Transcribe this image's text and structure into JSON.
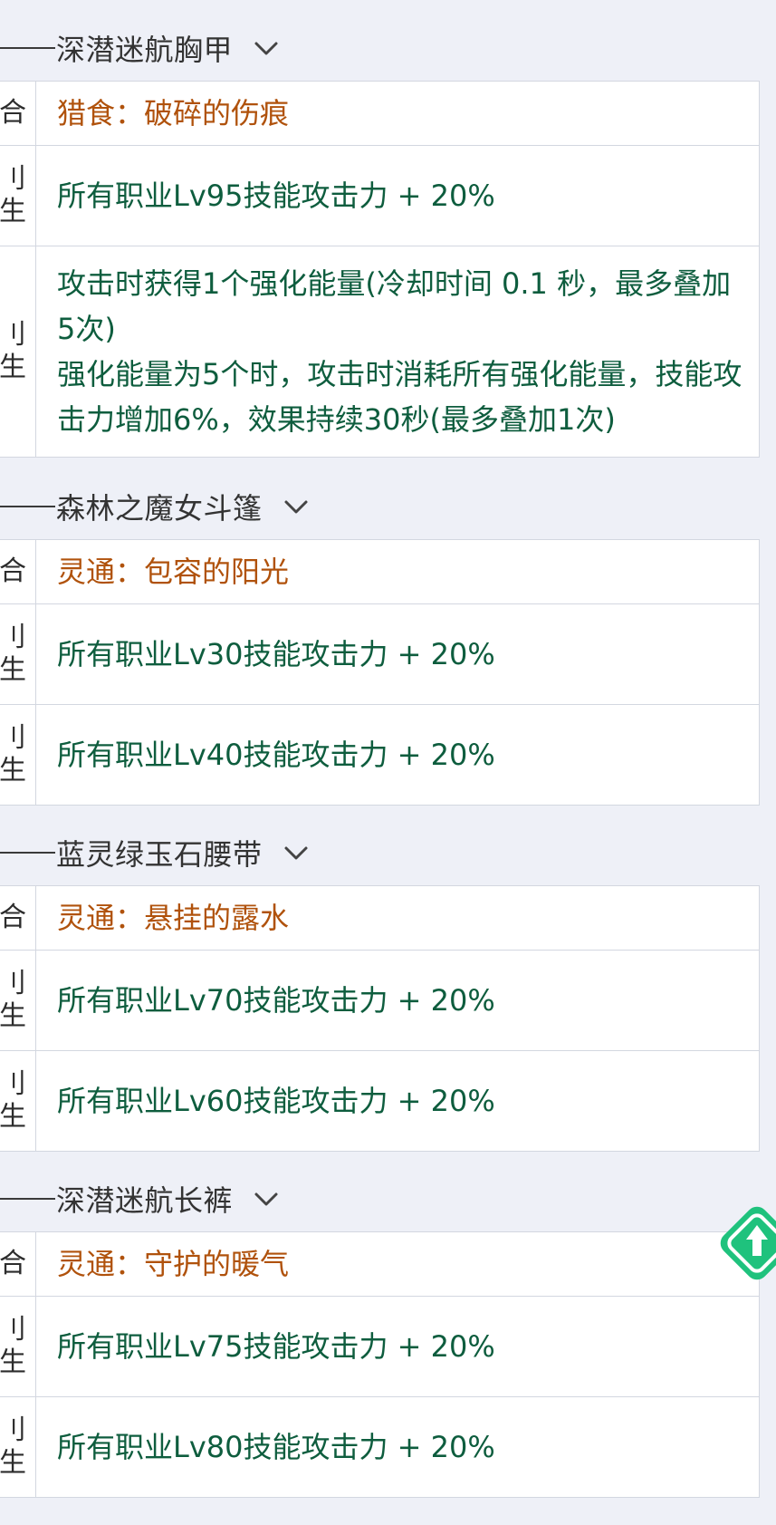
{
  "colors": {
    "background": "#eef0f7",
    "set_name": "#b0520c",
    "stat_text": "#0e5d3e",
    "float_button": "#1fc27d"
  },
  "icons": {
    "section_toggle": "chevron-down-icon",
    "float_button": "arrow-up-diamond-icon"
  },
  "sections": [
    {
      "title": "深潜迷航胸甲",
      "rows": [
        {
          "left": "合",
          "type": "set",
          "text": "猎食：破碎的伤痕"
        },
        {
          "left": "刂\n生",
          "type": "stat",
          "text": "所有职业Lv95技能攻击力 + 20%"
        },
        {
          "left": "刂\n生",
          "type": "stat",
          "text": "攻击时获得1个强化能量(冷却时间 0.1 秒，最多叠加5次)\n强化能量为5个时，攻击时消耗所有强化能量，技能攻击力增加6%，效果持续30秒(最多叠加1次)"
        }
      ]
    },
    {
      "title": "森林之魔女斗篷",
      "rows": [
        {
          "left": "合",
          "type": "set",
          "text": "灵通：包容的阳光"
        },
        {
          "left": "刂\n生",
          "type": "stat",
          "text": "所有职业Lv30技能攻击力 + 20%"
        },
        {
          "left": "刂\n生",
          "type": "stat",
          "text": "所有职业Lv40技能攻击力 + 20%"
        }
      ]
    },
    {
      "title": "蓝灵绿玉石腰带",
      "rows": [
        {
          "left": "合",
          "type": "set",
          "text": "灵通：悬挂的露水"
        },
        {
          "left": "刂\n生",
          "type": "stat",
          "text": "所有职业Lv70技能攻击力 + 20%"
        },
        {
          "left": "刂\n生",
          "type": "stat",
          "text": "所有职业Lv60技能攻击力 + 20%"
        }
      ]
    },
    {
      "title": "深潜迷航长裤",
      "rows": [
        {
          "left": "合",
          "type": "set",
          "text": "灵通：守护的暖气"
        },
        {
          "left": "刂\n生",
          "type": "stat",
          "text": "所有职业Lv75技能攻击力 + 20%"
        },
        {
          "left": "刂\n生",
          "type": "stat",
          "text": "所有职业Lv80技能攻击力 + 20%"
        }
      ]
    }
  ]
}
